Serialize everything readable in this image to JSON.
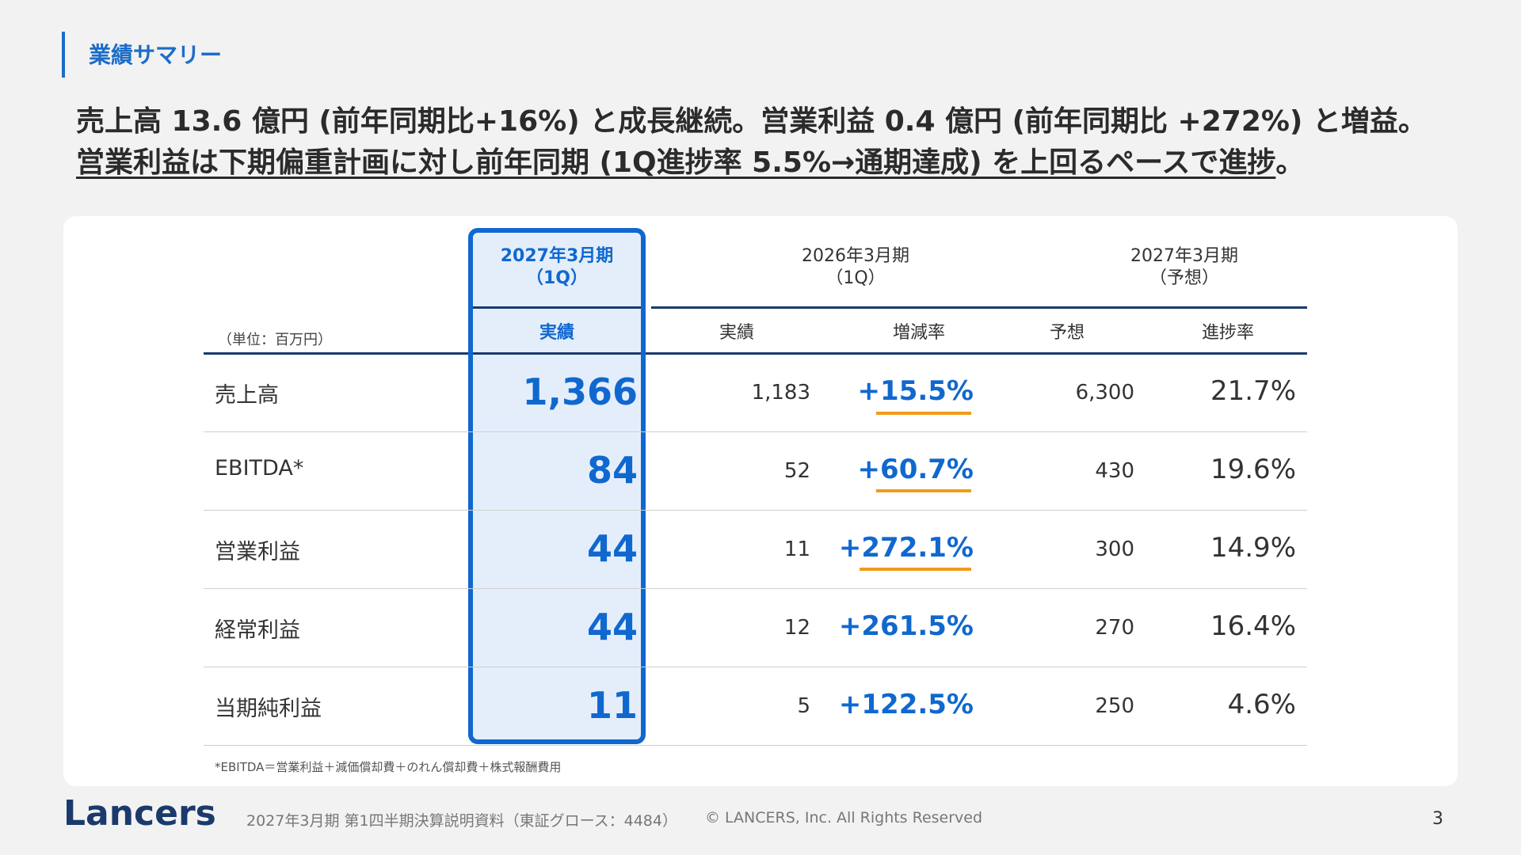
{
  "section_title": "業績サマリー",
  "headline_line1": "売上高 13.6 億円 (前年同期比+16%) と成長継続。営業利益 0.4 億円 (前年同期比 +272%) と増益。",
  "headline_line2": "営業利益は下期偏重計画に対し前年同期 (1Q進捗率 5.5%→通期達成) を上回るペースで進捗",
  "headline_line2_end": "。",
  "table": {
    "unit_label": "（単位：百万円）",
    "col_current": {
      "line1": "2027年3月期",
      "line2": "（1Q）",
      "sub": "実績"
    },
    "col_prev": {
      "line1": "2026年3月期",
      "line2": "（1Q）",
      "sub_actual": "実績",
      "sub_change": "増減率"
    },
    "col_forecast": {
      "line1": "2027年3月期",
      "line2": "（予想）",
      "sub_forecast": "予想",
      "sub_progress": "進捗率"
    },
    "rows": [
      {
        "label": "売上高",
        "current": "1,366",
        "prev": "1,183",
        "change": "+15.5%",
        "forecast": "6,300",
        "progress": "21.7%"
      },
      {
        "label": "EBITDA*",
        "current": "84",
        "prev": "52",
        "change": "+60.7%",
        "forecast": "430",
        "progress": "19.6%"
      },
      {
        "label": "営業利益",
        "current": "44",
        "prev": "11",
        "change": "+272.1%",
        "forecast": "300",
        "progress": "14.9%"
      },
      {
        "label": "経常利益",
        "current": "44",
        "prev": "12",
        "change": "+261.5%",
        "forecast": "270",
        "progress": "16.4%"
      },
      {
        "label": "当期純利益",
        "current": "11",
        "prev": "5",
        "change": "+122.5%",
        "forecast": "250",
        "progress": "4.6%"
      }
    ],
    "footnote": "*EBITDA＝営業利益＋減価償却費＋のれん償却費＋株式報酬費用"
  },
  "footer": {
    "logo": "Lancers",
    "doc_title": "2027年3月期 第1四半期決算説明資料（東証グロース：4484）",
    "copyright": "© LANCERS, Inc. All Rights Reserved",
    "page_number": "3"
  },
  "colors": {
    "accent": "#1068cf",
    "highlight_bg": "#e4eefb",
    "underline": "#f29a1b",
    "navy_line": "#1a3a6c"
  }
}
